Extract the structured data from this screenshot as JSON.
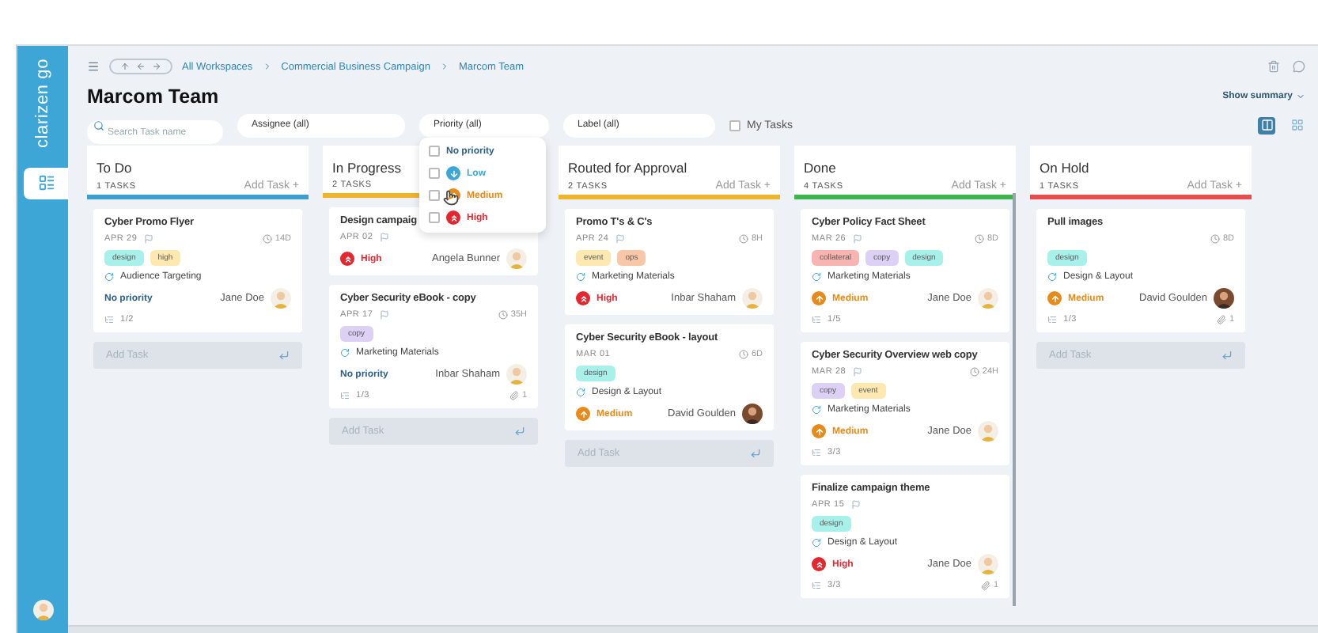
{
  "sidebar": {
    "logo": "clarizen go",
    "nav": [
      {
        "selected": true
      }
    ]
  },
  "topbar": {
    "breadcrumbs": [
      "All Workspaces",
      "Commercial Business Campaign",
      "Marcom Team"
    ]
  },
  "title": "Marcom Team",
  "show_summary": "Show summary",
  "filters": {
    "search": {
      "placeholder": "Search Task name"
    },
    "dropdowns": [
      "Assignee (all)",
      "Priority (all)",
      "Label (all)"
    ],
    "my_tasks": {
      "label": "My Tasks",
      "checked": false
    }
  },
  "views": [
    {
      "kind": "board",
      "selected": true
    },
    {
      "kind": "grid",
      "selected": false
    }
  ],
  "priority_menu": [
    {
      "kind": "none",
      "label": "No priority",
      "checked": false
    },
    {
      "kind": "low",
      "label": "Low",
      "checked": false
    },
    {
      "kind": "medium",
      "label": "Medium",
      "checked": false
    },
    {
      "kind": "high",
      "label": "High",
      "checked": false
    }
  ],
  "columns": [
    {
      "title": "To Do",
      "count": "1 TASKS",
      "add": "Add Task +",
      "color": "#3aa0d2",
      "add_placeholder": "Add Task",
      "cards": [
        {
          "title": "Cyber Promo Flyer",
          "date": "APR 29",
          "flag": true,
          "duration": "14D",
          "tags": [
            {
              "label": "design",
              "color": "#a8f0ea"
            },
            {
              "label": "high",
              "color": "#fde9b0"
            }
          ],
          "project": "Audience Targeting",
          "priority": {
            "kind": "none",
            "label": "No priority"
          },
          "assignee": {
            "name": "Jane Doe",
            "photo": false
          },
          "subtasks": "1/2"
        }
      ]
    },
    {
      "title": "In Progress",
      "count": "2 TASKS",
      "color": "#f0b429",
      "add_placeholder": "Add Task",
      "cards": [
        {
          "title": "Design campaig",
          "date": "APR 02",
          "flag": true,
          "priority": {
            "kind": "high",
            "label": "High"
          },
          "assignee": {
            "name": "Angela Bunner",
            "photo": false
          }
        },
        {
          "title": "Cyber Security eBook - copy",
          "date": "APR 17",
          "flag": true,
          "duration": "35H",
          "tags": [
            {
              "label": "copy",
              "color": "#ddd0f5"
            }
          ],
          "project": "Marketing Materials",
          "priority": {
            "kind": "none",
            "label": "No priority"
          },
          "assignee": {
            "name": "Inbar Shaham",
            "photo": false
          },
          "subtasks": "1/3",
          "attachments": "1"
        }
      ]
    },
    {
      "title": "Routed for Approval",
      "count": "2 TASKS",
      "add": "Add Task +",
      "color": "#f0b429",
      "add_placeholder": "Add Task",
      "cards": [
        {
          "title": "Promo T's & C's",
          "date": "APR 24",
          "flag": true,
          "duration": "8H",
          "tags": [
            {
              "label": "event",
              "color": "#fde9b0"
            },
            {
              "label": "ops",
              "color": "#f8c7a8"
            }
          ],
          "project": "Marketing Materials",
          "priority": {
            "kind": "high",
            "label": "High"
          },
          "assignee": {
            "name": "Inbar Shaham",
            "photo": false
          }
        },
        {
          "title": "Cyber Security eBook - layout",
          "date": "MAR 01",
          "flag": false,
          "duration": "6D",
          "tags": [
            {
              "label": "design",
              "color": "#a8f0ea"
            }
          ],
          "project": "Design & Layout",
          "priority": {
            "kind": "medium",
            "label": "Medium"
          },
          "assignee": {
            "name": "David Goulden",
            "photo": true
          }
        }
      ]
    },
    {
      "title": "Done",
      "count": "4 TASKS",
      "add": "Add Task +",
      "color": "#3cb54a",
      "cards": [
        {
          "title": "Cyber Policy Fact Sheet",
          "date": "MAR 26",
          "flag": true,
          "duration": "8D",
          "tags": [
            {
              "label": "collateral",
              "color": "#f8b4b0"
            },
            {
              "label": "copy",
              "color": "#ddd0f5"
            },
            {
              "label": "design",
              "color": "#a8f0ea"
            }
          ],
          "project": "Marketing Materials",
          "priority": {
            "kind": "medium",
            "label": "Medium"
          },
          "assignee": {
            "name": "Jane Doe",
            "photo": false
          },
          "subtasks": "1/5"
        },
        {
          "title": "Cyber Security Overview web copy",
          "date": "MAR 28",
          "flag": true,
          "duration": "24H",
          "tags": [
            {
              "label": "copy",
              "color": "#ddd0f5"
            },
            {
              "label": "event",
              "color": "#fde9b0"
            }
          ],
          "project": "Marketing Materials",
          "priority": {
            "kind": "medium",
            "label": "Medium"
          },
          "assignee": {
            "name": "Jane Doe",
            "photo": false
          },
          "subtasks": "3/3"
        },
        {
          "title": "Finalize campaign theme",
          "date": "APR 15",
          "flag": true,
          "tags": [
            {
              "label": "design",
              "color": "#a8f0ea"
            }
          ],
          "project": "Design & Layout",
          "priority": {
            "kind": "high",
            "label": "High"
          },
          "assignee": {
            "name": "Jane Doe",
            "photo": false
          },
          "subtasks": "3/3",
          "attachments": "1"
        }
      ]
    },
    {
      "title": "On Hold",
      "count": "1 TASKS",
      "add": "Add Task +",
      "color": "#e84c4c",
      "add_placeholder": "Add Task",
      "cards": [
        {
          "title": "Pull images",
          "duration": "8D",
          "tags": [
            {
              "label": "design",
              "color": "#a8f0ea"
            }
          ],
          "project": "Design & Layout",
          "priority": {
            "kind": "medium",
            "label": "Medium"
          },
          "assignee": {
            "name": "David Goulden",
            "photo": true
          },
          "subtasks": "1/3",
          "attachments": "1"
        }
      ]
    }
  ]
}
